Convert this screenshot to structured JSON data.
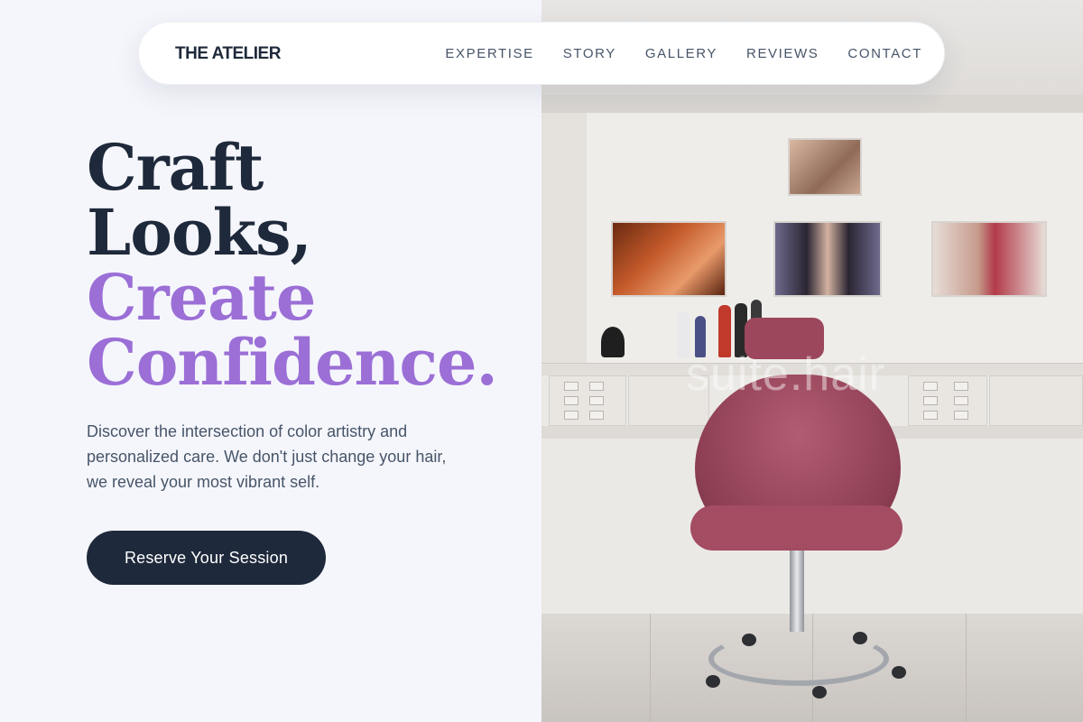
{
  "brand": "THE ATELIER",
  "nav": {
    "items": [
      "EXPERTISE",
      "STORY",
      "GALLERY",
      "REVIEWS",
      "CONTACT"
    ]
  },
  "hero": {
    "headline_line1": "Craft",
    "headline_line2": "Looks,",
    "headline_line3": "Create",
    "headline_line4": "Confidence.",
    "subtext": "Discover the intersection of color artistry and personalized care. We don't just change your hair, we reveal your most vibrant self.",
    "cta_label": "Reserve Your Session"
  },
  "photo": {
    "watermark": "suite.hair"
  },
  "colors": {
    "dark": "#1e293b",
    "accent": "#9b6fd6",
    "background": "#f5f6fc",
    "chair": "#9c475c"
  }
}
